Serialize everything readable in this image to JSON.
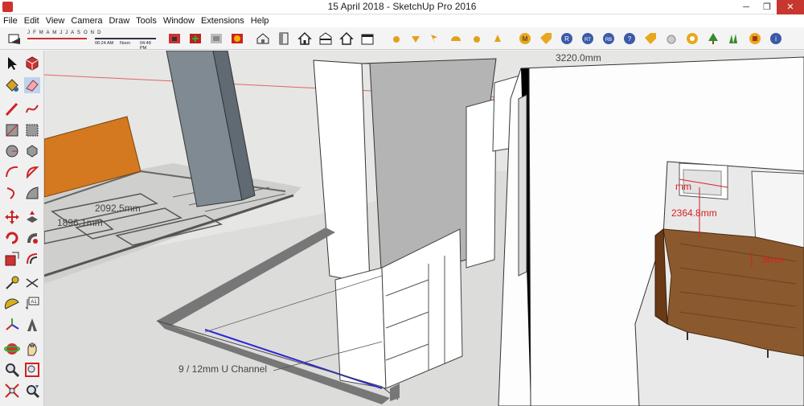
{
  "window": {
    "title": "15 April 2018 - SketchUp Pro 2016",
    "minimize": "─",
    "maximize": "❐",
    "close": "✕"
  },
  "menu": [
    "File",
    "Edit",
    "View",
    "Camera",
    "Draw",
    "Tools",
    "Window",
    "Extensions",
    "Help"
  ],
  "shadow_widget": {
    "months": "J F M A M J J A S O N D",
    "time_start": "06:24 AM",
    "time_mid": "Noon",
    "time_end": "04:48 PM"
  },
  "toolbar_icons": [
    "shadows-toggle-icon",
    "warehouse-icon",
    "share-model-icon",
    "extension-warehouse-icon",
    "layout-icon",
    "iso-view-icon",
    "top-view-icon",
    "front-view-icon",
    "right-view-icon",
    "back-view-icon",
    "left-view-icon",
    "plugin-dot-icons"
  ],
  "left_tools": [
    "select-icon",
    "make-component-icon",
    "paint-bucket-icon",
    "eraser-icon",
    "line-icon",
    "freehand-icon",
    "rectangle-icon",
    "rotated-rectangle-icon",
    "circle-icon",
    "polygon-icon",
    "arc-icon",
    "pie-icon",
    "two-point-arc-icon",
    "three-point-arc-icon",
    "move-icon",
    "push-pull-icon",
    "rotate-icon",
    "follow-me-icon",
    "scale-icon",
    "offset-icon",
    "tape-measure-icon",
    "dimension-icon",
    "protractor-icon",
    "text-icon",
    "axes-icon",
    "3d-text-icon",
    "orbit-icon",
    "pan-icon",
    "zoom-icon",
    "zoom-window-icon",
    "zoom-extents-icon",
    "previous-view-icon"
  ],
  "viewport": {
    "dims": {
      "d1": "3220.0mm",
      "d2": "2092.5mm",
      "d3": "1896.1mm",
      "d4": "2364.8mm",
      "d5": "mm",
      "d6": ".8mm",
      "label": "9 / 12mm U Channel"
    }
  },
  "colors": {
    "accent_red": "#d62020",
    "wood": "#8a5a2e",
    "orange_wall": "#d4791f",
    "sky": "#e6e6e4",
    "ground": "#d8d8d6"
  }
}
